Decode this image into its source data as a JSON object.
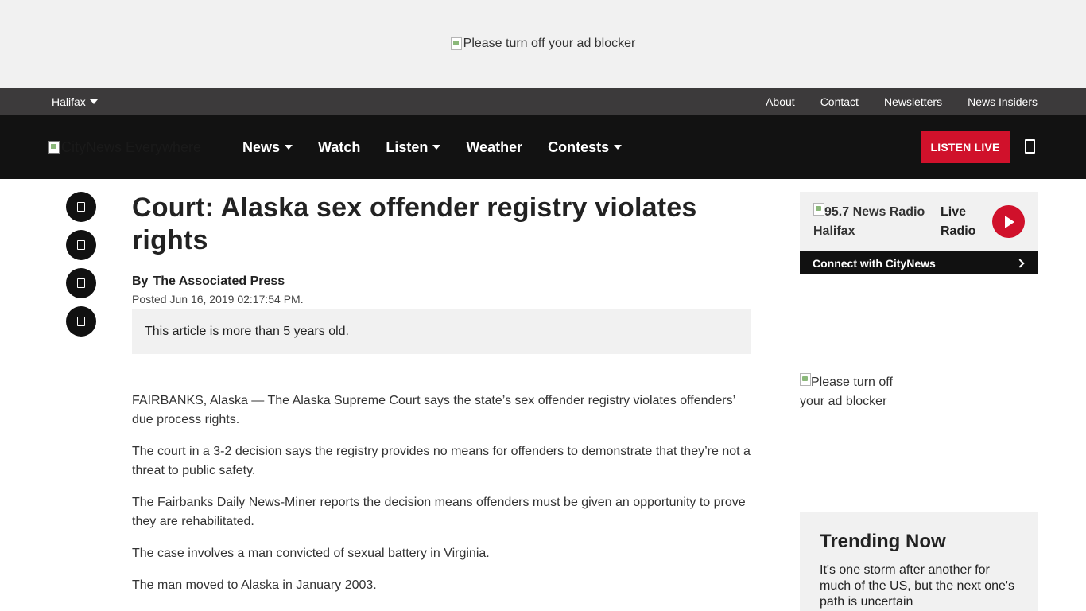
{
  "ad_top": {
    "alt": "Please turn off your ad blocker"
  },
  "topbar": {
    "location": "Halifax",
    "links": [
      "About",
      "Contact",
      "Newsletters",
      "News Insiders"
    ]
  },
  "nav": {
    "logo_alt": "CityNews Everywhere",
    "items": [
      {
        "label": "News",
        "dropdown": true
      },
      {
        "label": "Watch",
        "dropdown": false
      },
      {
        "label": "Listen",
        "dropdown": true
      },
      {
        "label": "Weather",
        "dropdown": false
      },
      {
        "label": "Contests",
        "dropdown": true
      }
    ],
    "listen_live": "LISTEN LIVE"
  },
  "share_icons": [
    "share-icon",
    "share-icon",
    "share-icon",
    "share-icon"
  ],
  "article": {
    "title": "Court: Alaska sex offender registry violates rights",
    "by": "By",
    "author": "The Associated Press",
    "posted": "Posted Jun 16, 2019 02:17:54 PM.",
    "age_note": "This article is more than 5 years old.",
    "paragraphs": [
      "FAIRBANKS, Alaska — The Alaska Supreme Court says the state’s sex offender registry violates offenders’ due process rights.",
      "The court in a 3-2 decision says the registry provides no means for offenders to demonstrate that they’re not a threat to public safety.",
      "The Fairbanks Daily News-Miner reports the decision means offenders must be given an opportunity to prove they are rehabilitated.",
      "The case involves a man convicted of sexual battery in Virginia.",
      "The man moved to Alaska in January 2003."
    ]
  },
  "sidebar": {
    "radio": {
      "station_alt": "95.7 News Radio Halifax",
      "live_label": "Live Radio"
    },
    "connect": "Connect with CityNews",
    "ad_alt": "Please turn off your ad blocker",
    "trending": {
      "title": "Trending Now",
      "headline": "It's one storm after another for much of the US, but the next one's path is uncertain"
    }
  },
  "colors": {
    "accent": "#d0112b",
    "nav_bg": "#121212",
    "topbar_bg": "#3c3a3b"
  }
}
